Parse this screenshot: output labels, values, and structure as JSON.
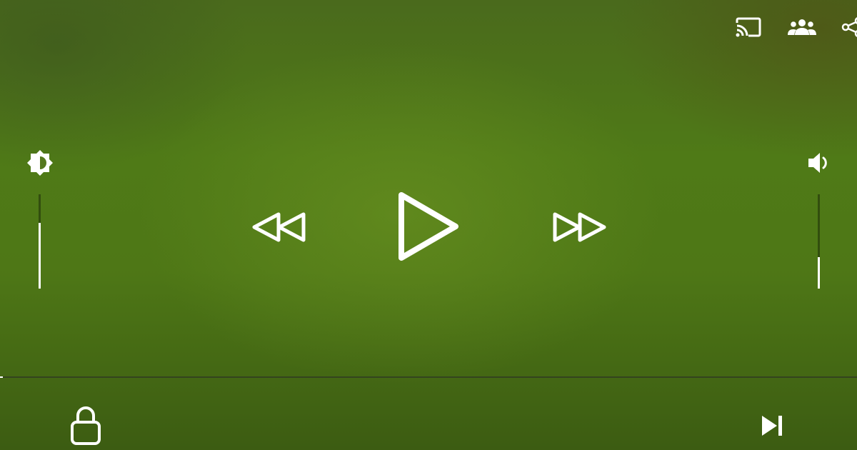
{
  "player": {
    "state": "paused",
    "background_color": "#4e7716",
    "accent_color": "#ffffff"
  },
  "top_bar": {
    "icons": [
      "cast-icon",
      "watch-party-icon",
      "share-icon"
    ]
  },
  "brightness": {
    "icon": "brightness-icon",
    "level": 0.7
  },
  "volume": {
    "icon": "volume-icon",
    "level": 0.33
  },
  "center_controls": {
    "icons": [
      "rewind-icon",
      "play-icon",
      "fast-forward-icon"
    ]
  },
  "seek": {
    "progress": 0.003
  },
  "bottom_bar": {
    "icons": [
      "lock-icon",
      "skip-next-icon"
    ]
  }
}
